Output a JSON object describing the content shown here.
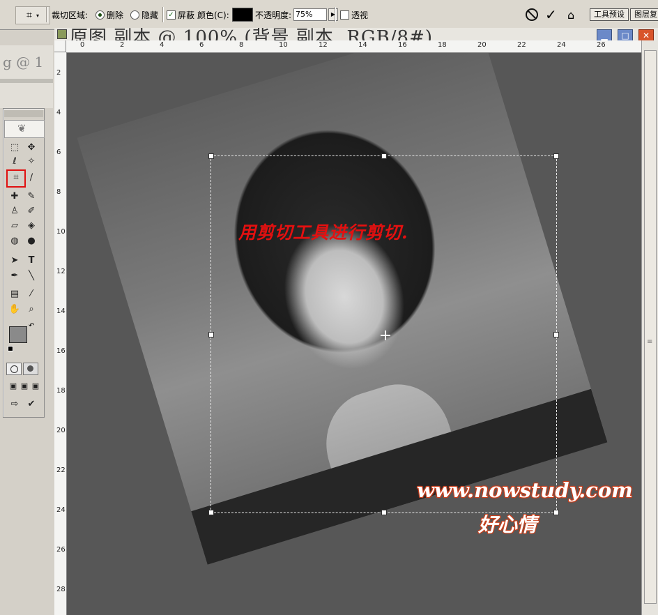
{
  "options_bar": {
    "crop_area_label": "裁切区域:",
    "delete_label": "删除",
    "hide_label": "隐藏",
    "shield_label": "屏蔽",
    "color_label": "颜色(C):",
    "color_value": "#000000",
    "opacity_label": "不透明度:",
    "opacity_value": "75%",
    "perspective_label": "透视",
    "tool_presets_tab": "工具预设",
    "layers_tab": "图层复"
  },
  "document": {
    "title": "原图 副本 @ 100% (背景 副本, RGB/8#)"
  },
  "ruler_top_ticks": [
    "0",
    "2",
    "4",
    "6",
    "8",
    "10",
    "12",
    "14",
    "16",
    "18",
    "20",
    "22",
    "24",
    "26"
  ],
  "ruler_left_ticks": [
    "2",
    "4",
    "6",
    "8",
    "10",
    "12",
    "14",
    "16",
    "18",
    "20",
    "22",
    "24",
    "26",
    "28"
  ],
  "left_strip": {
    "letters": "g @ 1"
  },
  "annotations": {
    "instruction": "用剪切工具进行剪切.",
    "website": "www.nowstudy.com",
    "signature": "好心情"
  }
}
